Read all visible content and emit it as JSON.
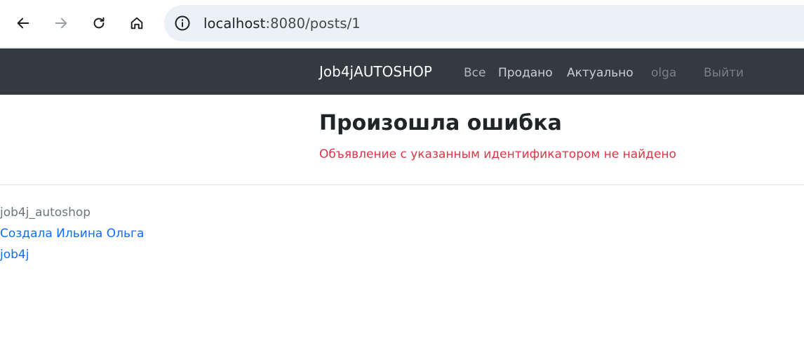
{
  "browser": {
    "back_icon": "arrow-left-icon",
    "forward_icon": "arrow-right-icon",
    "reload_icon": "reload-icon",
    "home_icon": "home-icon",
    "site_info_icon": "info-icon",
    "url_host": "localhost",
    "url_rest": ":8080/posts/1"
  },
  "navbar": {
    "brand": "Job4jAUTOSHOP",
    "links": {
      "all": "Все",
      "sold": "Продано",
      "actual": "Актуально",
      "user": "olga",
      "logout": "Выйти"
    }
  },
  "main": {
    "title": "Произошла ошибка",
    "message": "Объявление с указанным идентификатором не найдено"
  },
  "footer": {
    "brand": "job4j_autoshop",
    "author_link": "Создала Ильина Ольга",
    "job4j_link": "job4j"
  },
  "colors": {
    "navbar_bg": "#343a40",
    "error_text": "#dc3545",
    "link": "#0d6efd"
  }
}
